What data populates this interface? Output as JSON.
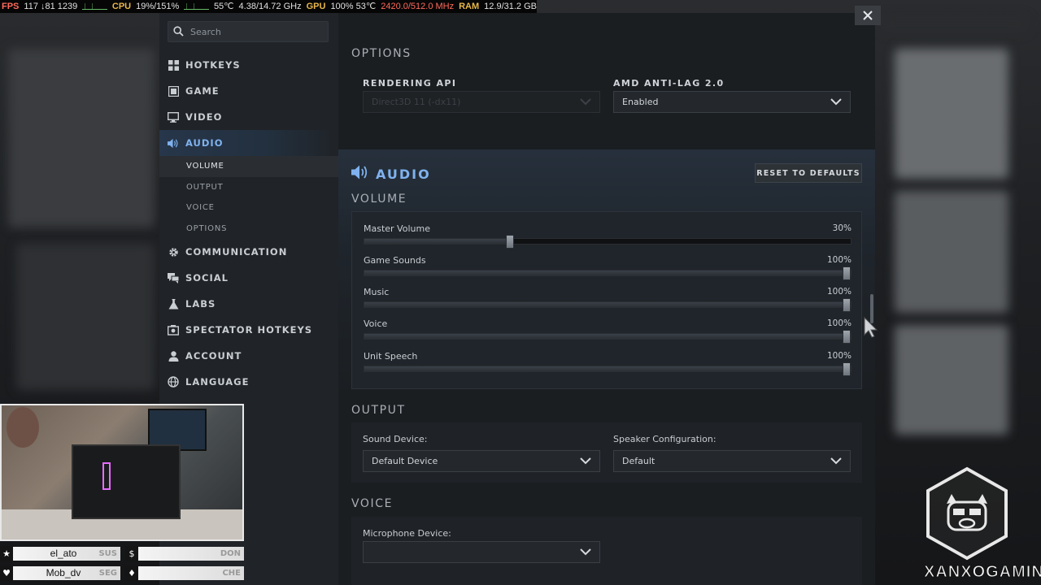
{
  "stat_bar": {
    "fps_label": "FPS",
    "fps_value": "117 ↓81 1239",
    "cpu_label": "CPU",
    "cpu_value": "19%/151%",
    "cpu_temp": "55℃",
    "cpu_clock": "4.38/14.72 GHz",
    "gpu_label": "GPU",
    "gpu_value": "100% 53℃",
    "gpu_clock": "2420.0/512.0 MHz",
    "ram_label": "RAM",
    "ram_value": "12.9/31.2 GB"
  },
  "search": {
    "placeholder": "Search"
  },
  "sidebar": {
    "items": [
      {
        "label": "HOTKEYS",
        "icon": "keyboard-icon"
      },
      {
        "label": "GAME",
        "icon": "game-icon"
      },
      {
        "label": "VIDEO",
        "icon": "monitor-icon"
      },
      {
        "label": "AUDIO",
        "icon": "speaker-icon",
        "active": true
      },
      {
        "label": "COMMUNICATION",
        "icon": "gear-icon"
      },
      {
        "label": "SOCIAL",
        "icon": "chat-icon"
      },
      {
        "label": "LABS",
        "icon": "flask-icon"
      },
      {
        "label": "SPECTATOR HOTKEYS",
        "icon": "camera-icon"
      },
      {
        "label": "ACCOUNT",
        "icon": "person-icon"
      },
      {
        "label": "LANGUAGE",
        "icon": "globe-icon"
      }
    ],
    "audio_subitems": [
      "VOLUME",
      "OUTPUT",
      "VOICE",
      "OPTIONS"
    ]
  },
  "options": {
    "heading": "OPTIONS",
    "rendering_api_label": "RENDERING API",
    "rendering_api_value": "Direct3D 11 (-dx11)",
    "anti_lag_label": "AMD ANTI-LAG 2.0",
    "anti_lag_value": "Enabled"
  },
  "audio": {
    "title": "AUDIO",
    "reset_label": "RESET TO DEFAULTS",
    "volume_heading": "VOLUME",
    "sliders": [
      {
        "label": "Master Volume",
        "value_text": "30%",
        "value": 0.3
      },
      {
        "label": "Game Sounds",
        "value_text": "100%",
        "value": 1.0
      },
      {
        "label": "Music",
        "value_text": "100%",
        "value": 1.0
      },
      {
        "label": "Voice",
        "value_text": "100%",
        "value": 1.0
      },
      {
        "label": "Unit Speech",
        "value_text": "100%",
        "value": 1.0
      }
    ],
    "output_heading": "OUTPUT",
    "sound_device_label": "Sound Device:",
    "sound_device_value": "Default Device",
    "speaker_config_label": "Speaker Configuration:",
    "speaker_config_value": "Default",
    "voice_heading": "VOICE",
    "microphone_label": "Microphone Device:",
    "microphone_value": ""
  },
  "votes": [
    {
      "icon": "★",
      "name": "el_ato",
      "tag": "SUS"
    },
    {
      "icon": "$",
      "name": "",
      "tag": "DON"
    },
    {
      "icon": "♥",
      "name": "Mob_dv",
      "tag": "SEG"
    },
    {
      "icon": "♦",
      "name": "",
      "tag": "CHE"
    }
  ],
  "watermark": "XANXOGAMING",
  "colors": {
    "accent": "#7fb2ee",
    "panel": "#1b1e21",
    "sidebar": "#202327"
  }
}
